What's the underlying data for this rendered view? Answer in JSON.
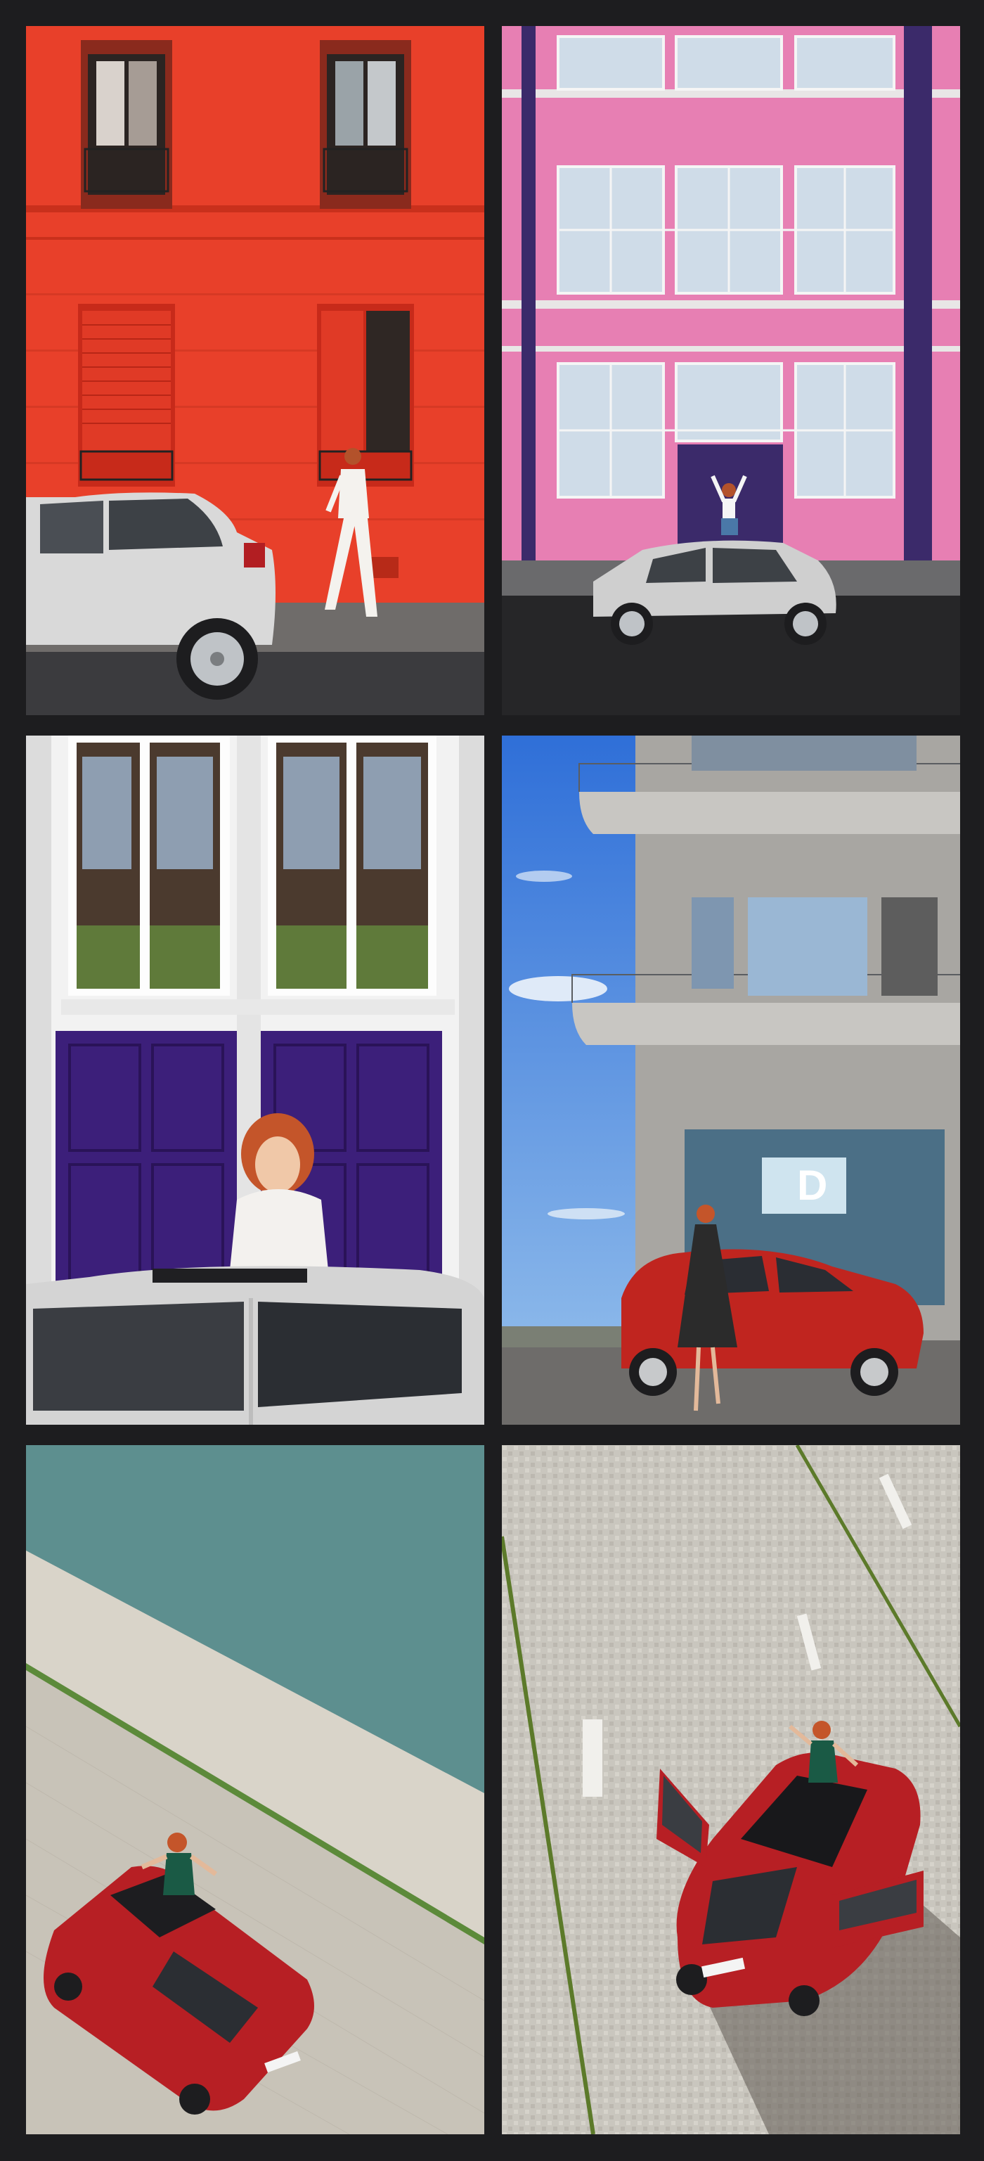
{
  "page": {
    "background": "#1d1d1f"
  },
  "gallery": {
    "tiles": [
      {
        "scene": "red-facade-walking",
        "palette": {
          "wall": "#e8402a",
          "car": "#d9d9d9",
          "street": "#3b3b3e"
        }
      },
      {
        "scene": "pink-building-hatch",
        "palette": {
          "wall": "#e77fb3",
          "accent": "#3b2a6a",
          "car": "#cfcfcf"
        }
      },
      {
        "scene": "purple-doors-sunroof",
        "palette": {
          "door": "#3c1f7a",
          "wall": "#f2f2f2",
          "car": "#d4d4d4"
        }
      },
      {
        "scene": "concrete-building-red-car",
        "palette": {
          "sky": "#3a7fe0",
          "concrete": "#a8a6a2",
          "car": "#c0251f"
        }
      },
      {
        "scene": "canal-quay-aerial",
        "palette": {
          "water": "#5d8f8f",
          "quay": "#d9d4c9",
          "car": "#b71f24"
        }
      },
      {
        "scene": "cobblestone-aerial-doors-open",
        "palette": {
          "cobble": "#c9c6be",
          "car": "#b71f24"
        }
      }
    ]
  }
}
